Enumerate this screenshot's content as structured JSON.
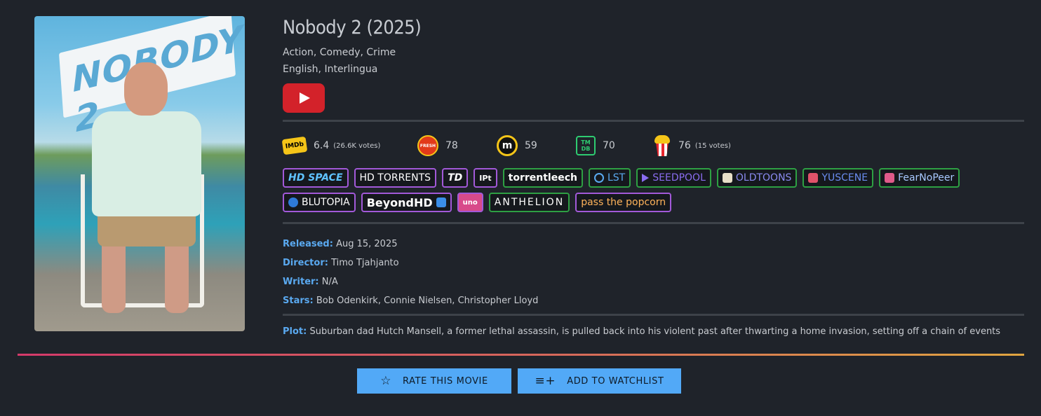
{
  "movie": {
    "title": "Nobody 2 (2025)",
    "genres": "Action, Comedy, Crime",
    "languages": "English, Interlingua",
    "poster_text": "NOBODY 2"
  },
  "ratings": [
    {
      "source": "imdb",
      "icon": "imdb-icon",
      "icon_label": "IMDb",
      "value": "6.4",
      "votes": "(26.6K votes)"
    },
    {
      "source": "rotten-tomatoes",
      "icon": "fresh-tomato-icon",
      "icon_label": "FRESH",
      "value": "78",
      "votes": ""
    },
    {
      "source": "metacritic",
      "icon": "metacritic-icon",
      "icon_label": "m",
      "value": "59",
      "votes": ""
    },
    {
      "source": "tmdb",
      "icon": "tmdb-icon",
      "icon_label": "TM DB",
      "value": "70",
      "votes": ""
    },
    {
      "source": "popcorn",
      "icon": "popcorn-icon",
      "icon_label": "",
      "value": "76",
      "votes": "(15 votes)"
    }
  ],
  "trackers": {
    "row1": [
      "HD SPACE",
      "HD TORRENTS",
      "TD",
      "IPt",
      "torrentleech",
      "LST",
      "SEEDPOOL",
      "OLDTOONS",
      "YUSCENE",
      "FearNoPeer"
    ],
    "row2": [
      "BLUTOPIA",
      "BeyondHD",
      "uno",
      "ANTHELION",
      "pass the popcorn"
    ]
  },
  "details": {
    "released_label": "Released:",
    "released": "Aug 15, 2025",
    "director_label": "Director:",
    "director": "Timo Tjahjanto",
    "writer_label": "Writer:",
    "writer": "N/A",
    "stars_label": "Stars:",
    "stars": "Bob Odenkirk, Connie Nielsen, Christopher Lloyd",
    "plot_label": "Plot:",
    "plot": "Suburban dad Hutch Mansell, a former lethal assassin, is pulled back into his violent past after thwarting a home invasion, setting off a chain of events"
  },
  "actions": {
    "rate_label": "RATE THIS MOVIE",
    "watchlist_label": "ADD TO WATCHLIST"
  },
  "colors": {
    "background": "#1f232a",
    "accent_blue": "#52a9f7",
    "label_blue": "#5aa9f0",
    "youtube_red": "#d3222a",
    "tracker_border": "#a259d9"
  }
}
